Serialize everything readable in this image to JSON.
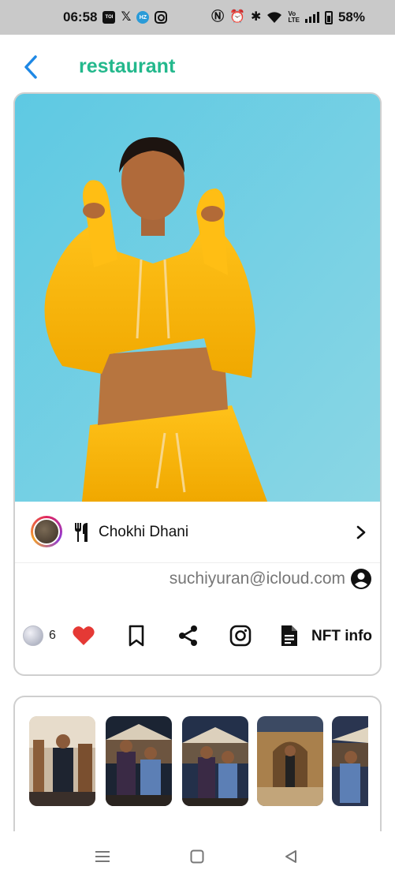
{
  "status_bar": {
    "time": "06:58",
    "app_icons": [
      "toi-icon",
      "x-icon",
      "hz-icon",
      "instagram-icon"
    ],
    "battery_percent": "58%"
  },
  "header": {
    "title": "restaurant"
  },
  "post": {
    "restaurant_name": "Chokhi Dhani",
    "owner_email": "suchiyuran@icloud.com",
    "coin_count": "6",
    "nft_info_label": "NFT info"
  },
  "gallery": {
    "thumbnail_count": 5
  },
  "colors": {
    "accent_teal": "#23b88c",
    "back_blue": "#1e88e5",
    "heart_red": "#e53935",
    "card_border": "#cfcfcf"
  }
}
